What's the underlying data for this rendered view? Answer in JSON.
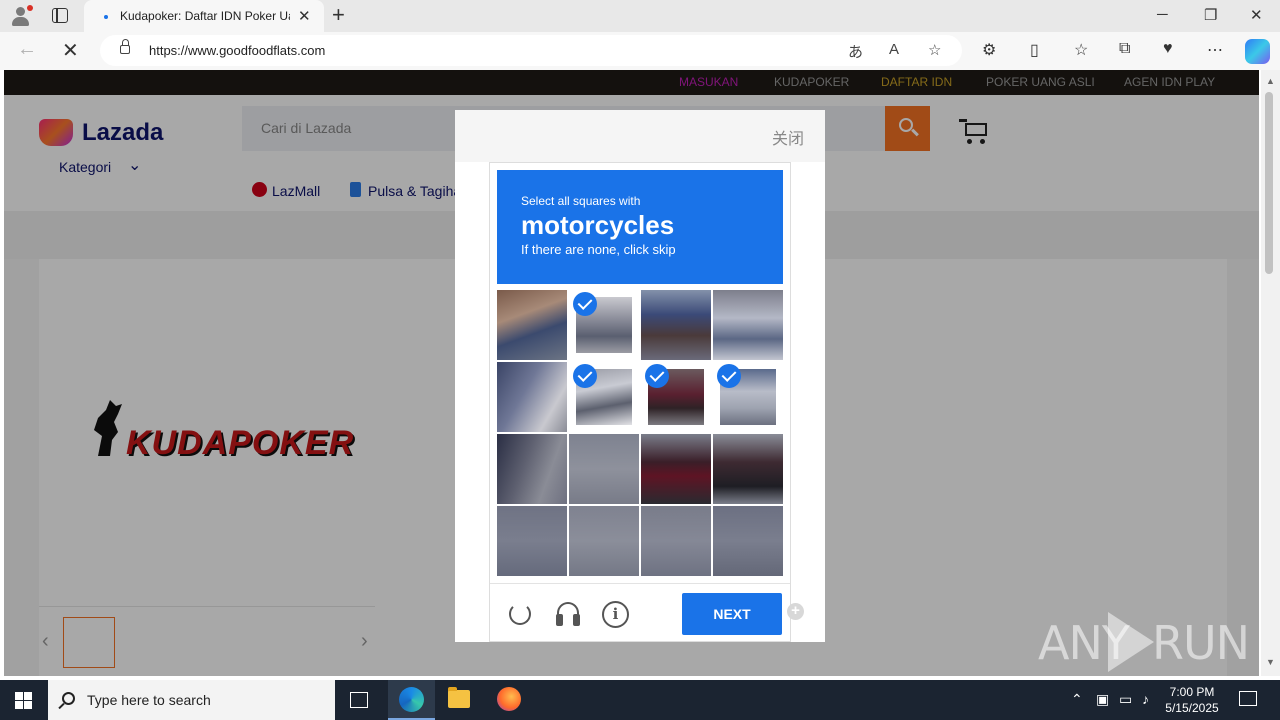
{
  "browser": {
    "tab_title": "Kudapoker: Daftar IDN Poker Uang",
    "url": "https://www.goodfoodflats.com",
    "new_tab": "+",
    "close_tab": "✕"
  },
  "site_nav": {
    "items": [
      {
        "label": "MASUKAN",
        "color": "#c21fb8"
      },
      {
        "label": "KUDAPOKER",
        "color": "#9a9a9a"
      },
      {
        "label": "DAFTAR IDN",
        "color": "#c9a227"
      },
      {
        "label": "POKER UANG ASLI",
        "color": "#9a9a9a"
      },
      {
        "label": "AGEN IDN PLAY",
        "color": "#9a9a9a"
      }
    ]
  },
  "lazada": {
    "brand": "Lazada",
    "search_placeholder": "Cari di Lazada",
    "kategori": "Kategori",
    "lazmall": "LazMall",
    "pulsa": "Pulsa & Tagiha"
  },
  "product": {
    "logo_text": "KUDAPOKER"
  },
  "modal": {
    "close_label": "关闭"
  },
  "captcha": {
    "instruction_line1": "Select all squares with",
    "target": "motorcycles",
    "instruction_line3": "If there are none, click skip",
    "next_label": "NEXT",
    "selected_tiles": [
      1,
      5,
      6,
      7
    ]
  },
  "watermark": {
    "left": "ANY",
    "right": "RUN"
  },
  "taskbar": {
    "search_placeholder": "Type here to search",
    "time": "7:00 PM",
    "date": "5/15/2025"
  }
}
